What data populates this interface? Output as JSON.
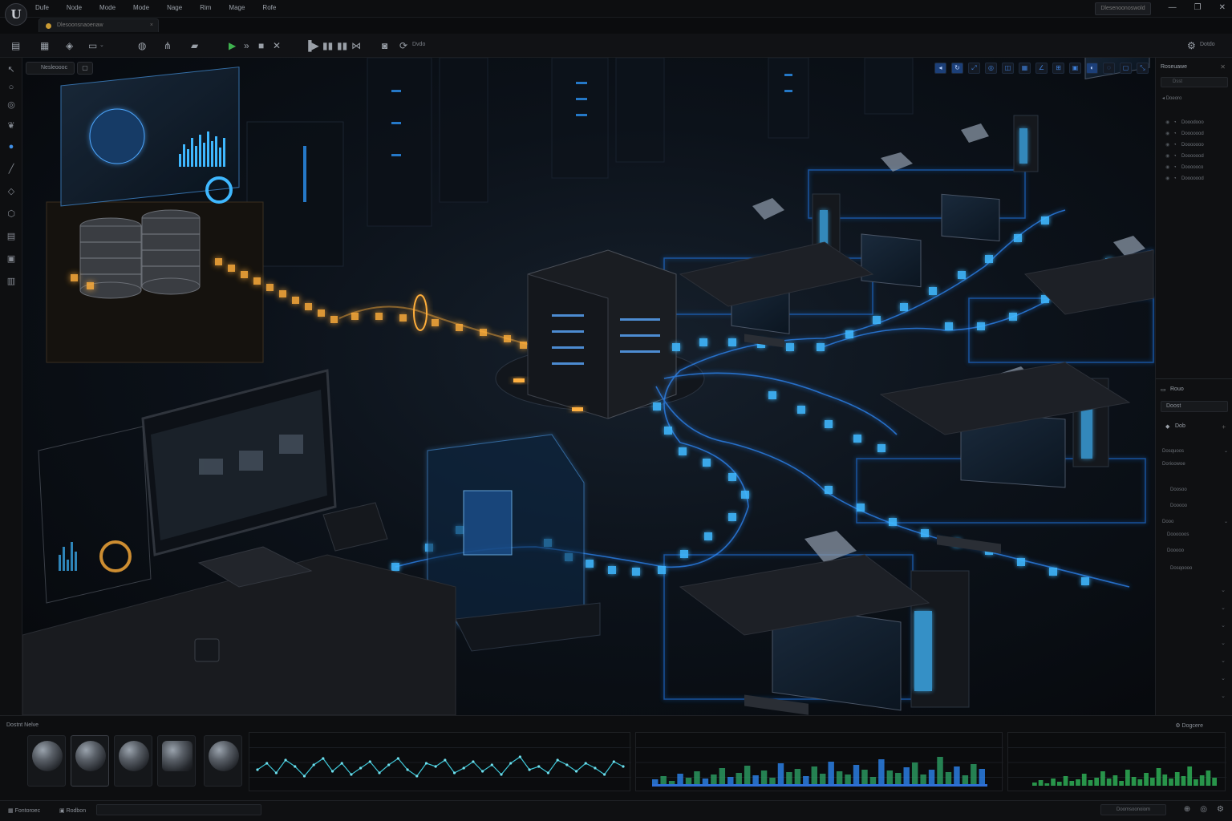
{
  "app": {
    "logo": "U",
    "menus": [
      "Dufe",
      "Node",
      "Mode",
      "Mode",
      "Nage",
      "Rim",
      "Mage",
      "Rofe"
    ],
    "project_button": "Dlesenoonoswold",
    "window_controls": [
      "—",
      "❐",
      "✕"
    ],
    "level_tab": "Dlesoonsnaoenaw"
  },
  "toolbar": {
    "icons": [
      "save-icon",
      "folder-icon",
      "mode-icon",
      "platform-icon",
      "blueprint-icon",
      "graph-icon",
      "cinematic-icon",
      "play-icon",
      "skip-icon",
      "stop-icon",
      "eject-icon",
      "frame-icon",
      "pause-icon",
      "pause2-icon",
      "step-icon",
      "record-icon",
      "build-icon"
    ],
    "build_label": "Dvdo",
    "settings_label": "Dotdo"
  },
  "viewport": {
    "mode_chip": "Nesleoooc",
    "tools_count": 13
  },
  "outliner": {
    "title": "Roseuawe",
    "search_placeholder": "Dsst",
    "root": "Doeoro",
    "items": [
      "Dooodooo",
      "Dooooood",
      "Dooooooo",
      "Dooooood",
      "Doooooco",
      "Dooooood"
    ]
  },
  "details": {
    "tab": "Rouo",
    "object_name": "Doost",
    "section": "Dob",
    "rows": [
      "Dosquoos",
      "Dorioowoe",
      "Doosoo",
      "Dooooo",
      "Dooo",
      "Doooooos",
      "Dooooo",
      "Dosqoooo"
    ]
  },
  "content_browser": {
    "title": "Dostnt Nelve",
    "assets": [
      "sphere-mesh",
      "sphere-mesh-2",
      "sphere-mesh-3",
      "cylinder-mesh",
      "metal-sphere"
    ]
  },
  "charts": {
    "cyan_line": [
      22,
      30,
      18,
      34,
      26,
      14,
      28,
      36,
      20,
      30,
      16,
      24,
      32,
      18,
      28,
      36,
      22,
      14,
      30,
      26,
      34,
      18,
      24,
      32,
      20,
      28,
      16,
      30,
      38,
      22,
      26,
      18,
      34,
      28,
      20,
      30,
      24,
      16,
      32,
      26
    ],
    "activity_bars": [
      8,
      12,
      6,
      15,
      10,
      18,
      9,
      14,
      22,
      11,
      16,
      25,
      13,
      19,
      10,
      28,
      17,
      21,
      12,
      24,
      15,
      30,
      18,
      14,
      26,
      20,
      11,
      33,
      19,
      16,
      23,
      29,
      14,
      20,
      36,
      17,
      24,
      13,
      27,
      21
    ],
    "green_bars": [
      4,
      7,
      3,
      9,
      5,
      12,
      6,
      8,
      15,
      7,
      10,
      18,
      9,
      13,
      6,
      20,
      11,
      8,
      16,
      10,
      22,
      14,
      9,
      17,
      12,
      24,
      8,
      13,
      19,
      10
    ]
  },
  "status_bar": {
    "content_drawer": "Fontoroec",
    "output_log": "Rodbon",
    "source_control": "Doomsoonoiom",
    "icons": [
      "notify-icon",
      "source-icon",
      "settings-icon"
    ]
  },
  "colors": {
    "accent_blue": "#2f8cff",
    "glow_cyan": "#3fb8ff",
    "glow_orange": "#ffae3a",
    "play_green": "#3fb24f",
    "panel_bg": "#0f1012"
  }
}
